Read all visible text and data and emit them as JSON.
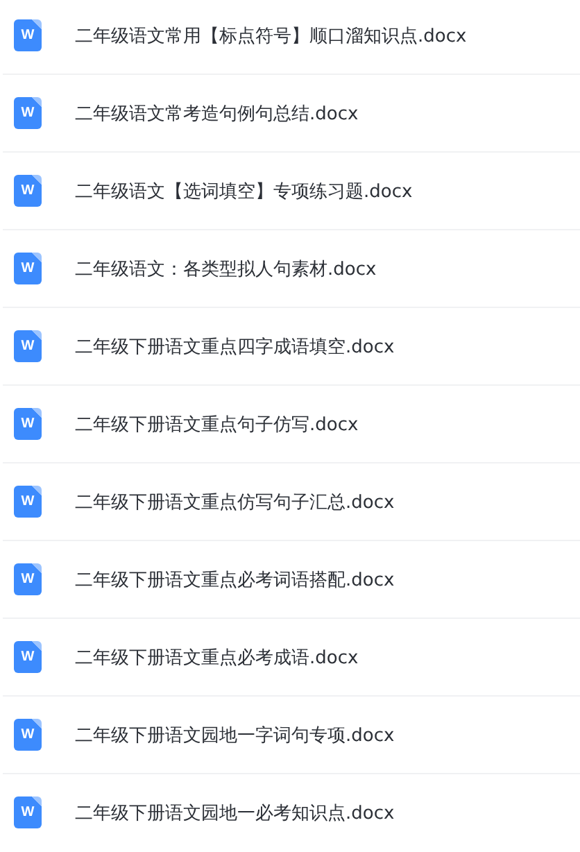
{
  "files": [
    {
      "name": "二年级语文常用【标点符号】顺口溜知识点.docx",
      "icon_label": "W"
    },
    {
      "name": "二年级语文常考造句例句总结.docx",
      "icon_label": "W"
    },
    {
      "name": "二年级语文【选词填空】专项练习题.docx",
      "icon_label": "W"
    },
    {
      "name": "二年级语文：各类型拟人句素材.docx",
      "icon_label": "W"
    },
    {
      "name": "二年级下册语文重点四字成语填空.docx",
      "icon_label": "W"
    },
    {
      "name": "二年级下册语文重点句子仿写.docx",
      "icon_label": "W"
    },
    {
      "name": "二年级下册语文重点仿写句子汇总.docx",
      "icon_label": "W"
    },
    {
      "name": "二年级下册语文重点必考词语搭配.docx",
      "icon_label": "W"
    },
    {
      "name": "二年级下册语文重点必考成语.docx",
      "icon_label": "W"
    },
    {
      "name": "二年级下册语文园地一字词句专项.docx",
      "icon_label": "W"
    },
    {
      "name": "二年级下册语文园地一必考知识点.docx",
      "icon_label": "W"
    }
  ]
}
